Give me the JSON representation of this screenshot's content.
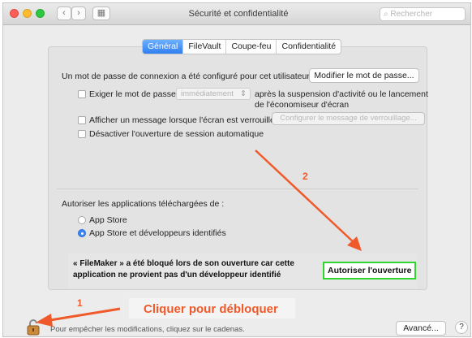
{
  "window": {
    "title": "Sécurité et confidentialité",
    "search_placeholder": "Rechercher",
    "back_symbol": "‹",
    "forward_symbol": "›",
    "grid_symbol": "▦"
  },
  "tabs": [
    {
      "label": "Général",
      "active": true
    },
    {
      "label": "FileVault",
      "active": false
    },
    {
      "label": "Coupe-feu",
      "active": false
    },
    {
      "label": "Confidentialité",
      "active": false
    }
  ],
  "general": {
    "password_text": "Un mot de passe de connexion a été configuré pour cet utilisateur",
    "change_password_button": "Modifier le mot de passe...",
    "require_password_label": "Exiger le mot de passe",
    "require_password_select": "immédiatement",
    "require_password_suffix_line1": "après la suspension d'activité ou le lancement",
    "require_password_suffix_line2": "de l'économiseur d'écran",
    "show_message_label": "Afficher un message lorsque l'écran est verrouillé",
    "configure_message_button": "Configurer le message de verrouillage...",
    "disable_auto_login_label": "Désactiver l'ouverture de session automatique"
  },
  "apps": {
    "heading": "Autoriser les applications téléchargées de :",
    "options": [
      {
        "label": "App Store",
        "selected": false
      },
      {
        "label": "App Store et développeurs identifiés",
        "selected": true
      }
    ],
    "blocked_line1": "« FileMaker » a été bloqué lors de son ouverture car cette",
    "blocked_line2": "application ne provient pas d'un développeur identifié",
    "allow_button": "Autoriser l'ouverture"
  },
  "annotations": {
    "step1": "1",
    "step2": "2",
    "unlock_callout": "Cliquer pour débloquer",
    "arrow_color": "#f05a2a",
    "highlight_color": "#2fd62f"
  },
  "footer": {
    "lock_text": "Pour empêcher les modifications, cliquez sur le cadenas.",
    "advanced_button": "Avancé...",
    "help_button": "?"
  }
}
